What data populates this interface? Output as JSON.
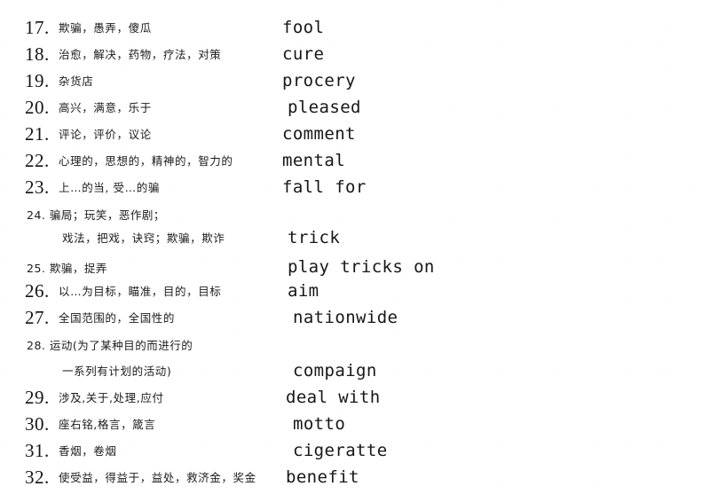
{
  "document": {
    "type": "vocabulary-word-list",
    "language_pair": "Chinese-English",
    "background_color": "#ffffff",
    "text_color": "#161616",
    "first_item": "17",
    "last_item": "32"
  },
  "entries": [
    {
      "number": "17.",
      "chinese": "欺骗，愚弄，傻瓜",
      "english": "fool",
      "style": "large"
    },
    {
      "number": "18.",
      "chinese": "治愈，解决，药物，疗法，对策",
      "english": "cure",
      "style": "large"
    },
    {
      "number": "19.",
      "chinese": "杂货店",
      "english": "procery",
      "style": "large"
    },
    {
      "number": "20.",
      "chinese": "高兴，满意，乐于",
      "english": "pleased",
      "style": "large"
    },
    {
      "number": "21.",
      "chinese": "评论，评价，议论",
      "english": "comment",
      "style": "large"
    },
    {
      "number": "22.",
      "chinese": "心理的，思想的，精神的，智力的",
      "english": "mental",
      "style": "large"
    },
    {
      "number": "23.",
      "chinese": "上…的当, 受…的骗",
      "english": "fall for",
      "style": "large"
    },
    {
      "number": "24.",
      "chinese": "骗局；玩笑，恶作剧；",
      "english": "",
      "style": "small-inline",
      "inline_text": "24. 骗局；玩笑，恶作剧；"
    },
    {
      "number": "",
      "chinese": "戏法，把戏，诀窍；欺骗，欺诈",
      "english": "trick",
      "style": "continuation"
    },
    {
      "number": "25.",
      "chinese": "欺骗，捉弄",
      "english": "play tricks on",
      "style": "small-inline",
      "inline_text": "25. 欺骗，捉弄"
    },
    {
      "number": "26.",
      "chinese": "以…为目标，瞄准，目的，目标",
      "english": "aim",
      "style": "large"
    },
    {
      "number": "27.",
      "chinese": "全国范围的，全国性的",
      "english": "nationwide",
      "style": "large"
    },
    {
      "number": "28.",
      "chinese": "运动(为了某种目的而进行的",
      "english": "",
      "style": "small-inline",
      "inline_text": "28. 运动(为了某种目的而进行的"
    },
    {
      "number": "",
      "chinese": "一系列有计划的活动)",
      "english": "compaign",
      "style": "continuation"
    },
    {
      "number": "29.",
      "chinese": "涉及,关于,处理,应付",
      "english": "deal with",
      "style": "large"
    },
    {
      "number": "30.",
      "chinese": "座右铭,格言，箴言",
      "english": "motto",
      "style": "large"
    },
    {
      "number": "31.",
      "chinese": "香烟，卷烟",
      "english": "cigeratte",
      "style": "large"
    },
    {
      "number": "32.",
      "chinese": "使受益，得益于，益处，救济金，奖金",
      "english": "benefit",
      "style": "large"
    }
  ]
}
